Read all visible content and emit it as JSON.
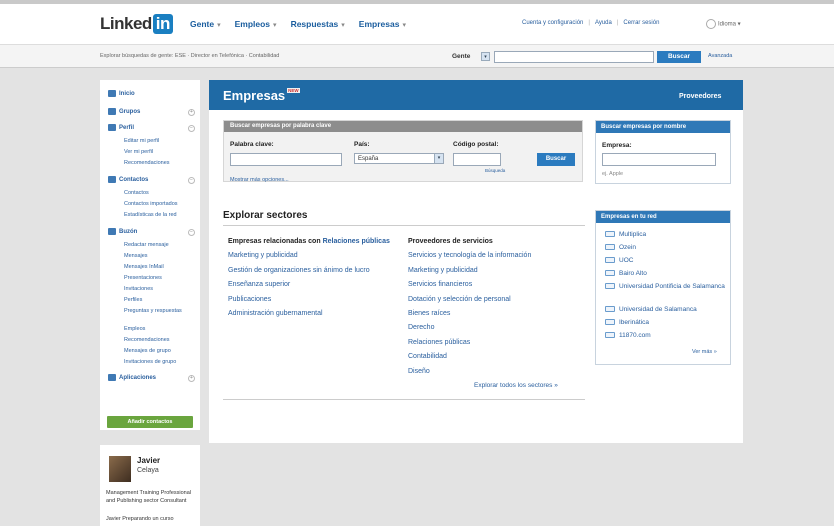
{
  "header": {
    "logo_text": "Linked",
    "logo_in": "in",
    "nav": [
      {
        "label": "Gente"
      },
      {
        "label": "Empleos"
      },
      {
        "label": "Respuestas"
      },
      {
        "label": "Empresas"
      }
    ],
    "user_links": [
      "Cuenta y configuración",
      "Ayuda",
      "Cerrar sesión"
    ],
    "idioma": "Idioma"
  },
  "search_bar": {
    "hint": "Explorar búsquedas de gente: ESE · Director en Telefónica · Contabilidad",
    "scope": "Gente",
    "button": "Buscar",
    "advanced": "Avanzada"
  },
  "sidebar": {
    "items": [
      {
        "label": "Inicio",
        "icon": "home-icon"
      },
      {
        "label": "Grupos",
        "icon": "groups-icon"
      },
      {
        "label": "Perfil",
        "icon": "profile-icon"
      },
      {
        "label": "Contactos",
        "icon": "contacts-icon"
      },
      {
        "label": "Buzón",
        "icon": "inbox-icon"
      },
      {
        "label": "Aplicaciones",
        "icon": "apps-icon"
      }
    ],
    "perfil_sub": [
      "Editar mi perfil",
      "Ver mi perfil",
      "Recomendaciones"
    ],
    "contactos_sub": [
      "Contactos",
      "Contactos importados",
      "Estadísticas de la red"
    ],
    "buzon_sub": [
      "Redactar mensaje",
      "Mensajes",
      "Mensajes InMail",
      "Presentaciones",
      "Invitaciones",
      "Perfiles",
      "Preguntas y respuestas",
      "Empleos",
      "Recomendaciones",
      "Mensajes de grupo",
      "Invitaciones de grupo"
    ],
    "add_contacts": "Añadir contactos"
  },
  "profile": {
    "first_name": "Javier",
    "last_name": "Celaya",
    "headline": "Management Training Professional and Publishing sector Consultant",
    "status": "Javier Preparando un curso"
  },
  "main": {
    "title": "Empresas",
    "new_badge": "NEW",
    "providers_link": "Proveedores",
    "keyword_box": {
      "heading": "Buscar empresas por palabra clave",
      "keyword_label": "Palabra clave:",
      "country_label": "País:",
      "country_value": "España",
      "postal_label": "Código postal:",
      "postal_lookup": "Búsqueda",
      "button": "Buscar",
      "more_options": "Mostrar más opciones..."
    },
    "sectors": {
      "title": "Explorar sectores",
      "col1_head_prefix": "Empresas relacionadas con",
      "col1_head_link": "Relaciones públicas",
      "col1": [
        "Marketing y publicidad",
        "Gestión de organizaciones sin ánimo de lucro",
        "Enseñanza superior",
        "Publicaciones",
        "Administración gubernamental"
      ],
      "col2_head": "Proveedores de servicios",
      "col2": [
        "Servicios y tecnología de la información",
        "Marketing y publicidad",
        "Servicios financieros",
        "Dotación y selección de personal",
        "Bienes raíces",
        "Derecho",
        "Relaciones públicas",
        "Contabilidad",
        "Diseño"
      ],
      "explore_all": "Explorar todos los sectores »"
    }
  },
  "right": {
    "name_box": {
      "heading": "Buscar empresas por nombre",
      "label": "Empresa:",
      "example": "ej. Apple"
    },
    "network_box": {
      "heading": "Empresas en tu red",
      "companies": [
        "Multiplica",
        "Ozein",
        "UOC",
        "Bairo Alto",
        "Universidad Pontificia de Salamanca",
        "Universidad de Salamanca",
        "Iberinática",
        "11870.com"
      ],
      "see_more": "Ver más »"
    }
  }
}
